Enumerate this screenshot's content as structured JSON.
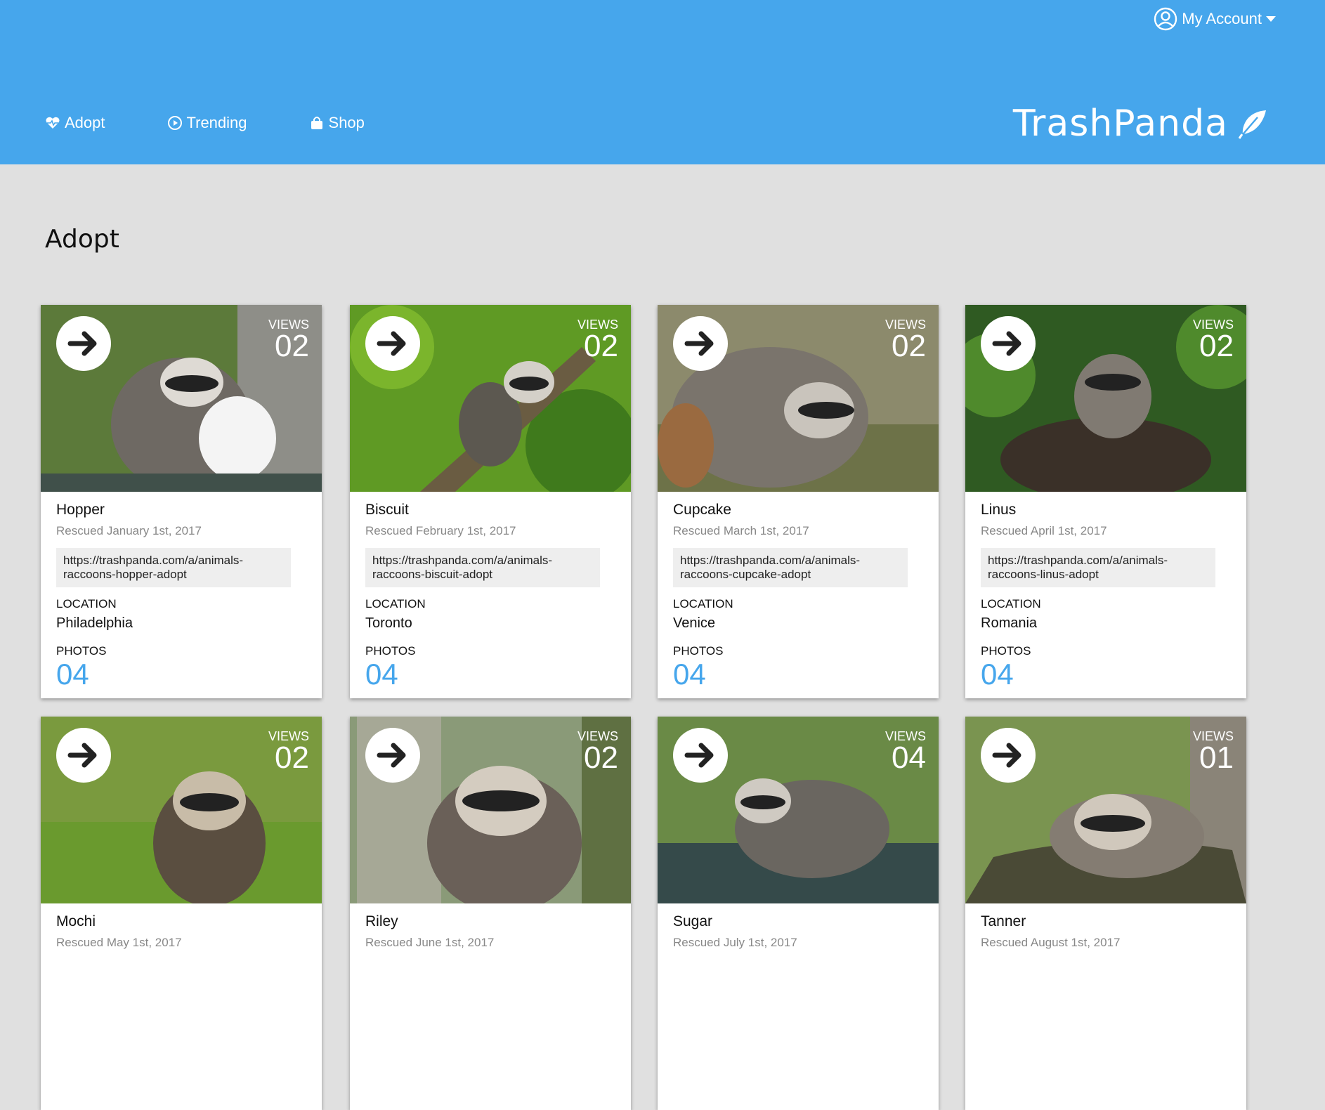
{
  "header": {
    "account_label": "My Account",
    "brand": "TrashPanda",
    "nav": [
      {
        "label": "Adopt"
      },
      {
        "label": "Trending"
      },
      {
        "label": "Shop"
      }
    ]
  },
  "page": {
    "title": "Adopt"
  },
  "colors": {
    "header": "#46a6ec",
    "accent": "#46a6ec",
    "background": "#e0e0e0"
  },
  "cards": [
    {
      "name": "Hopper",
      "rescued": "Rescued January 1st, 2017",
      "url": "https://trashpanda.com/a/animals-raccoons-hopper-adopt",
      "location_label": "LOCATION",
      "location": "Philadelphia",
      "photos_label": "PHOTOS",
      "photos": "04",
      "views_label": "VIEWS",
      "views": "02"
    },
    {
      "name": "Biscuit",
      "rescued": "Rescued February 1st, 2017",
      "url": "https://trashpanda.com/a/animals-raccoons-biscuit-adopt",
      "location_label": "LOCATION",
      "location": "Toronto",
      "photos_label": "PHOTOS",
      "photos": "04",
      "views_label": "VIEWS",
      "views": "02"
    },
    {
      "name": "Cupcake",
      "rescued": "Rescued March 1st, 2017",
      "url": "https://trashpanda.com/a/animals-raccoons-cupcake-adopt",
      "location_label": "LOCATION",
      "location": "Venice",
      "photos_label": "PHOTOS",
      "photos": "04",
      "views_label": "VIEWS",
      "views": "02"
    },
    {
      "name": "Linus",
      "rescued": "Rescued April 1st, 2017",
      "url": "https://trashpanda.com/a/animals-raccoons-linus-adopt",
      "location_label": "LOCATION",
      "location": "Romania",
      "photos_label": "PHOTOS",
      "photos": "04",
      "views_label": "VIEWS",
      "views": "02"
    },
    {
      "name": "Mochi",
      "rescued": "Rescued May 1st, 2017",
      "views_label": "VIEWS",
      "views": "02"
    },
    {
      "name": "Riley",
      "rescued": "Rescued June 1st, 2017",
      "views_label": "VIEWS",
      "views": "02"
    },
    {
      "name": "Sugar",
      "rescued": "Rescued July 1st, 2017",
      "views_label": "VIEWS",
      "views": "04"
    },
    {
      "name": "Tanner",
      "rescued": "Rescued August 1st, 2017",
      "views_label": "VIEWS",
      "views": "01"
    }
  ]
}
